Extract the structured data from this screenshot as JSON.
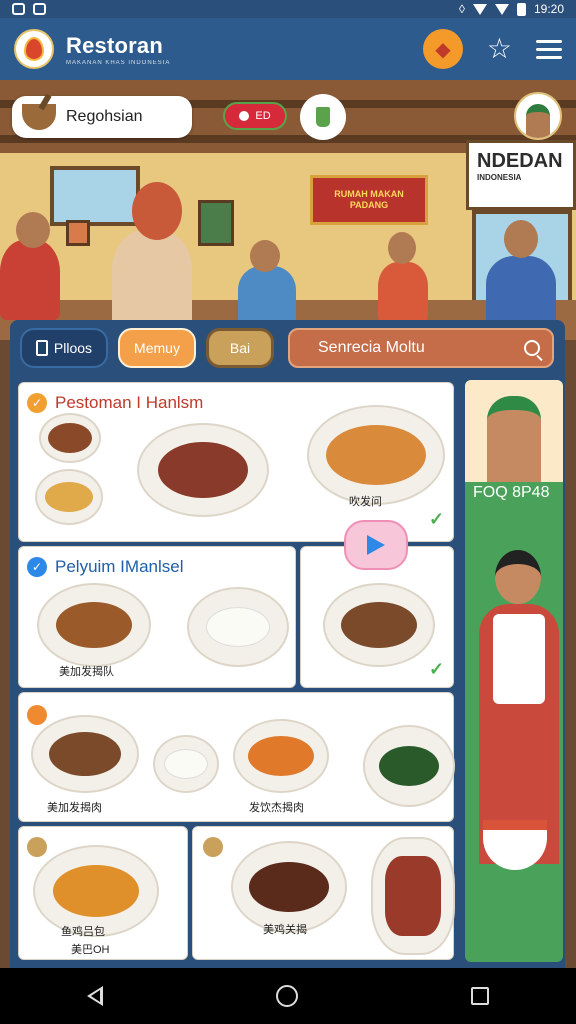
{
  "status": {
    "time": "19:20"
  },
  "app": {
    "title": "Restoran",
    "subtitle": "MAKANAN KHAS INDONESIA"
  },
  "hero": {
    "region_label": "Regohsian",
    "toggle_label": "ED",
    "sign_red_line1": "RUMAH MAKAN",
    "sign_red_line2": "PADANG",
    "sign_white": "NDEDAN",
    "sign_white_sub": "INDONESIA"
  },
  "tabs": [
    {
      "label": "Plloos"
    },
    {
      "label": "Memuy"
    },
    {
      "label": "Bai"
    }
  ],
  "search": {
    "placeholder": "Senrecia Moltu"
  },
  "cards": {
    "c1": {
      "title": "Pestoman I Hanlsm",
      "item_label": "吹发问"
    },
    "c2": {
      "title": "Pelyuim IManlsel",
      "item_label": "美加发揭队"
    },
    "c3": {
      "item_label_a": "美加发揭肉",
      "item_label_b": "发饮杰揭肉"
    },
    "c4": {
      "item_label_a": "鱼鸡吕包",
      "item_label_b": "美巴OH",
      "item_label_c": "美鸡关揭"
    }
  },
  "side": {
    "price": "FOQ 8P48"
  },
  "colors": {
    "app_bar": "#2d5b8e",
    "accent_orange": "#f4a04a",
    "accent_green": "#4aa25a",
    "search": "#c46d48"
  }
}
